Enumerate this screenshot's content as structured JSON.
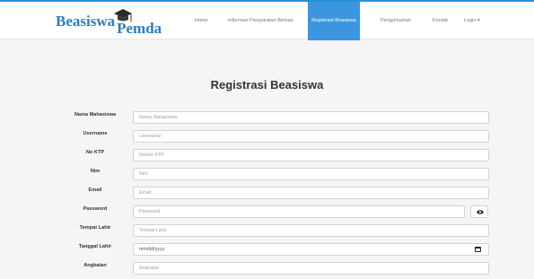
{
  "brand": {
    "part1": "Beasiswa",
    "part2": "Pemda"
  },
  "nav": {
    "home": "Home",
    "info": "Informasi Persyaratan Berkas",
    "registrasi": "Registrasi Beasiswa",
    "pengumuman": "Pengumuman",
    "kontak": "Kontak",
    "login": "Login ▾"
  },
  "page": {
    "title": "Registrasi Beasiswa"
  },
  "form": {
    "nama": {
      "label": "Nama Mahasiswa",
      "placeholder": "Nama Mahasiswa"
    },
    "username": {
      "label": "Username",
      "placeholder": "Username"
    },
    "ktp": {
      "label": "No KTP",
      "placeholder": "Nomor KTP"
    },
    "nim": {
      "label": "Nim",
      "placeholder": "Nim"
    },
    "email": {
      "label": "Email",
      "placeholder": "Email"
    },
    "password": {
      "label": "Password",
      "placeholder": "Password"
    },
    "tempat_lahir": {
      "label": "Tempat Lahir",
      "placeholder": "Tempat Lahir"
    },
    "tanggal_lahir": {
      "label": "Tanggal Lahir",
      "value": "mm/dd/yyyy"
    },
    "angkatan": {
      "label": "Angkatan",
      "placeholder": "Angkatan"
    }
  },
  "icons": {
    "brand": "graduation-cap-icon",
    "password_toggle": "eye-icon",
    "date": "calendar-icon"
  },
  "colors": {
    "accent": "#3c95de",
    "brand": "#2d7cc0"
  }
}
